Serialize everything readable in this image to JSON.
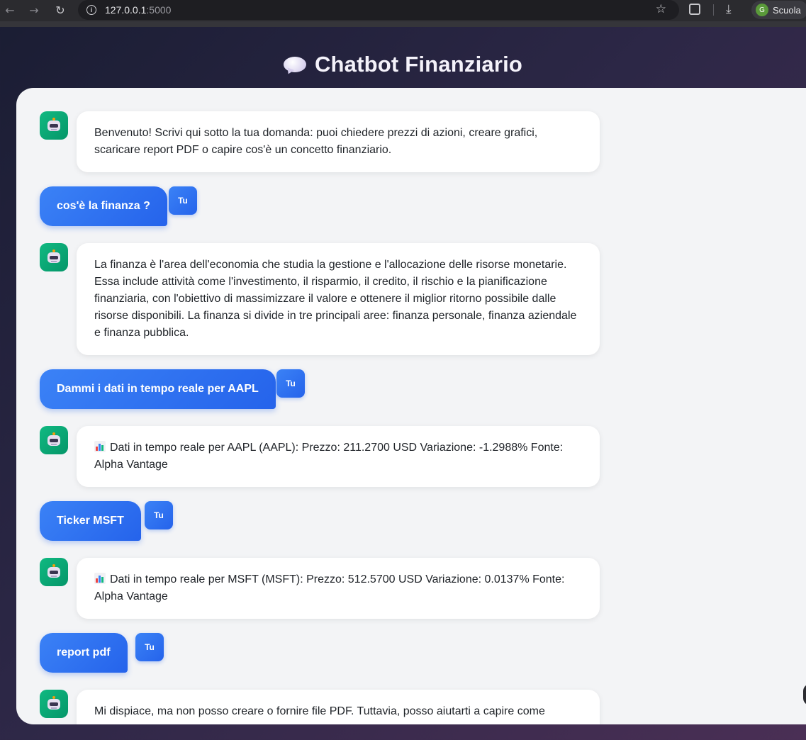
{
  "browser": {
    "url_host": "127.0.0.1",
    "url_port": ":5000",
    "profile_initial": "G",
    "profile_name": "Scuola",
    "icons": [
      "back-arrow-icon",
      "forward-arrow-icon",
      "reload-icon",
      "site-info-icon",
      "star-icon",
      "extensions-icon",
      "download-icon"
    ]
  },
  "header": {
    "title": "Chatbot Finanziario",
    "icon": "speech-bubble-icon"
  },
  "chat": {
    "user_badge": "Tu",
    "messages": [
      {
        "role": "bot",
        "text": "Benvenuto! Scrivi qui sotto la tua domanda: puoi chiedere prezzi di azioni, creare grafici, scaricare report PDF o capire cos'è un concetto finanziario."
      },
      {
        "role": "user",
        "text": "cos'è la finanza ?"
      },
      {
        "role": "bot",
        "text": "La finanza è l'area dell'economia che studia la gestione e l'allocazione delle risorse monetarie. Essa include attività come l'investimento, il risparmio, il credito, il rischio e la pianificazione finanziaria, con l'obiettivo di massimizzare il valore e ottenere il miglior ritorno possibile dalle risorse disponibili. La finanza si divide in tre principali aree: finanza personale, finanza aziendale e finanza pubblica."
      },
      {
        "role": "user",
        "text": "Dammi i dati in tempo reale per AAPL"
      },
      {
        "role": "bot",
        "icon": "bar-chart-icon",
        "text": "Dati in tempo reale per AAPL (AAPL): Prezzo: 211.2700 USD Variazione: -1.2988% Fonte: Alpha Vantage"
      },
      {
        "role": "user",
        "text": "Ticker MSFT"
      },
      {
        "role": "bot",
        "icon": "bar-chart-icon",
        "text": "Dati in tempo reale per MSFT (MSFT): Prezzo: 512.5700 USD Variazione: 0.0137% Fonte: Alpha Vantage"
      },
      {
        "role": "user",
        "text": "report pdf"
      },
      {
        "role": "bot",
        "text": "Mi dispiace, ma non posso creare o fornire file PDF. Tuttavia, posso aiutarti a capire come"
      }
    ]
  }
}
